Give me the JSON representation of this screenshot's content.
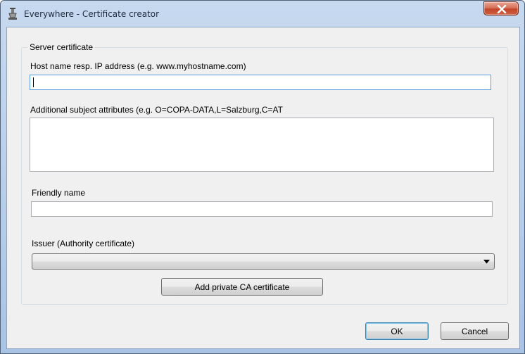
{
  "window": {
    "title": "Everywhere - Certificate creator",
    "app_icon": "certificate-app-icon",
    "close_icon": "close-icon"
  },
  "server_certificate": {
    "group_title": "Server certificate",
    "host_label": "Host name resp. IP address (e.g. www.myhostname.com)",
    "host_value": "",
    "attributes_label": "Additional subject attributes (e.g. O=COPA-DATA,L=Salzburg,C=AT",
    "attributes_value": "",
    "friendly_label": "Friendly name",
    "friendly_value": "",
    "issuer_label": "Issuer (Authority certificate)",
    "issuer_value": "",
    "add_ca_button": "Add private CA certificate"
  },
  "footer": {
    "ok_button": "OK",
    "cancel_button": "Cancel"
  }
}
